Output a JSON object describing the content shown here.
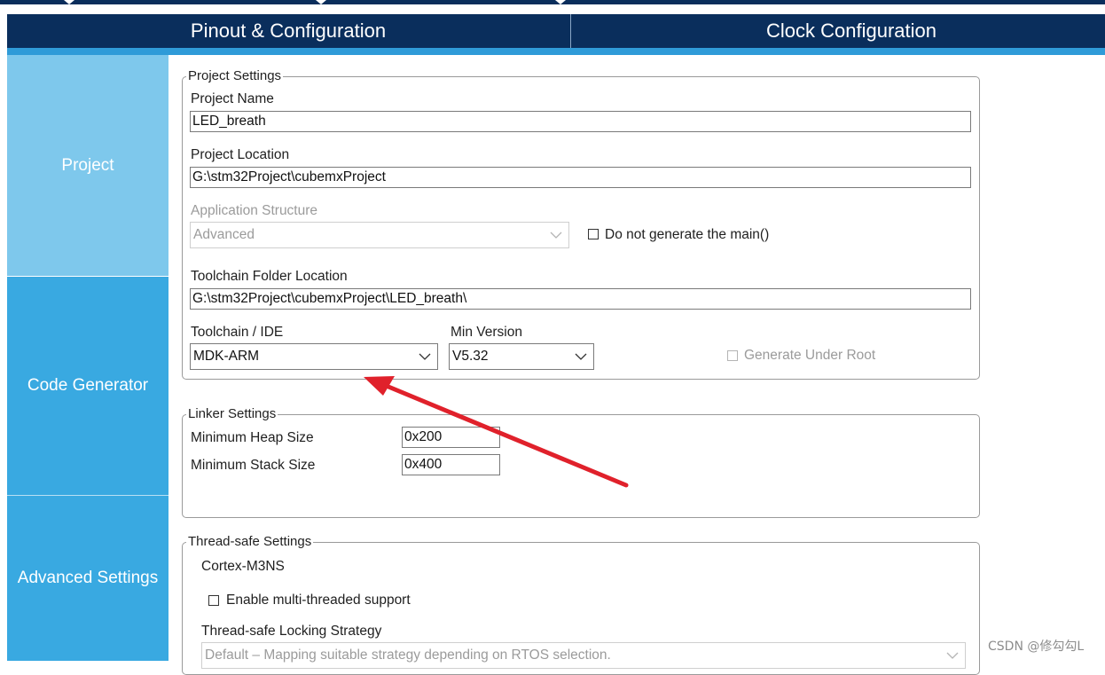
{
  "header": {
    "tab_pinout": "Pinout & Configuration",
    "tab_clock": "Clock Configuration"
  },
  "sidebar": {
    "items": [
      {
        "label": "Project",
        "state": "selected"
      },
      {
        "label": "Code Generator"
      },
      {
        "label": "Advanced Settings"
      }
    ]
  },
  "project_settings": {
    "title": "Project Settings",
    "project_name_label": "Project Name",
    "project_name_value": "LED_breath",
    "project_location_label": "Project Location",
    "project_location_value": "G:\\stm32Project\\cubemxProject",
    "app_structure_label": "Application Structure",
    "app_structure_value": "Advanced",
    "do_not_generate_main_label": "Do not generate the main()",
    "toolchain_folder_label": "Toolchain Folder Location",
    "toolchain_folder_value": "G:\\stm32Project\\cubemxProject\\LED_breath\\",
    "toolchain_ide_label": "Toolchain / IDE",
    "toolchain_ide_value": "MDK-ARM",
    "min_version_label": "Min Version",
    "min_version_value": "V5.32",
    "generate_under_root_label": "Generate Under Root"
  },
  "linker_settings": {
    "title": "Linker Settings",
    "heap_label": "Minimum Heap Size",
    "heap_value": "0x200",
    "stack_label": "Minimum Stack Size",
    "stack_value": "0x400"
  },
  "thread_safe_settings": {
    "title": "Thread-safe Settings",
    "core_label": "Cortex-M3NS",
    "enable_mt_label": "Enable multi-threaded support",
    "locking_strategy_label": "Thread-safe Locking Strategy",
    "locking_strategy_value": "Default  –  Mapping suitable strategy depending on RTOS selection."
  },
  "watermark": "CSDN @修勾勾\u0004L",
  "colors": {
    "header_bg": "#0a2e5c",
    "accent": "#2f9bd8",
    "sidebar_selected": "#7ec8ec",
    "sidebar_normal": "#39a9e1",
    "arrow": "#e0212b"
  }
}
